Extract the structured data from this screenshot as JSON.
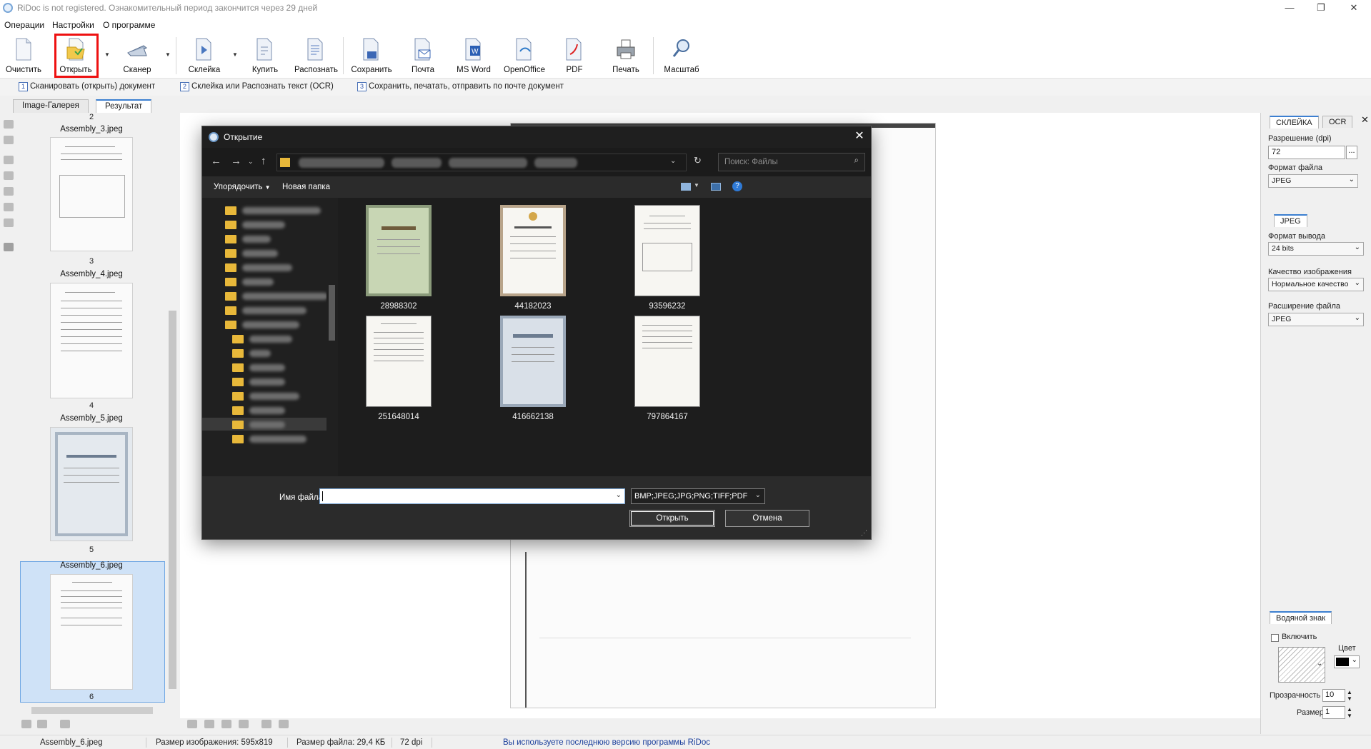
{
  "window": {
    "title": "RiDoc is not registered. Ознакомительный период закончится через 29 дней",
    "controls": [
      "—",
      "❐",
      "✕"
    ]
  },
  "menu": [
    "Операции",
    "Настройки",
    "О программе"
  ],
  "toolbar": {
    "clear": "Очистить",
    "open": "Открыть",
    "scanner": "Сканер",
    "glue": "Склейка",
    "buy": "Купить",
    "recognize": "Распознать",
    "save": "Сохранить",
    "mail": "Почта",
    "msword": "MS Word",
    "openoffice": "OpenOffice",
    "pdf": "PDF",
    "print": "Печать",
    "zoom": "Масштаб"
  },
  "steps": [
    {
      "num": "1",
      "text": "Сканировать (открыть) документ"
    },
    {
      "num": "2",
      "text": "Склейка или Распознать текст (OCR)"
    },
    {
      "num": "3",
      "text": "Сохранить, печатать, отправить по почте документ"
    }
  ],
  "tabs": [
    "Image-Галерея",
    "Результат"
  ],
  "gallery": {
    "items": [
      {
        "num": "2",
        "name": "Assembly_3.jpeg",
        "page": "3"
      },
      {
        "name": "Assembly_4.jpeg",
        "page": "4"
      },
      {
        "name": "Assembly_5.jpeg",
        "page": "5"
      },
      {
        "name": "Assembly_6.jpeg",
        "page": "6"
      }
    ]
  },
  "right_panel": {
    "tabs": [
      "СКЛЕЙКА",
      "OCR"
    ],
    "resolution_label": "Разрешение (dpi)",
    "resolution_value": "72",
    "resolution_btn": "...",
    "file_format_label": "Формат файла",
    "file_format_value": "JPEG",
    "subtab": "JPEG",
    "output_format_label": "Формат вывода",
    "output_format_value": "24 bits",
    "quality_label": "Качество изображения",
    "quality_value": "Нормальное качество",
    "extension_label": "Расширение файла",
    "extension_value": "JPEG",
    "watermark_tab": "Водяной знак",
    "watermark_enable": "Включить",
    "watermark_color_label": "Цвет",
    "transparency_label": "Прозрачность",
    "transparency_value": "10",
    "size_label": "Размер",
    "size_value": "1"
  },
  "dialog": {
    "title": "Открытие",
    "search_placeholder": "Поиск: Файлы",
    "organize": "Упорядочить",
    "new_folder": "Новая папка",
    "files": [
      "28988302",
      "44182023",
      "93596232",
      "251648014",
      "416662138",
      "797864167"
    ],
    "filename_label": "Имя файла:",
    "filename_value": "",
    "filetype": "BMP;JPEG;JPG;PNG;TIFF;PDF",
    "open_btn": "Открыть",
    "cancel_btn": "Отмена"
  },
  "status": {
    "file": "Assembly_6.jpeg",
    "image_size": "Размер изображения: 595x819",
    "file_size": "Размер файла: 29,4 КБ",
    "dpi": "72 dpi",
    "message": "Вы используете последнюю версию программы RiDoc"
  },
  "colors": {
    "accent": "#3c7fd0",
    "highlight": "#ee1111",
    "status_link": "#1a3f9c"
  }
}
